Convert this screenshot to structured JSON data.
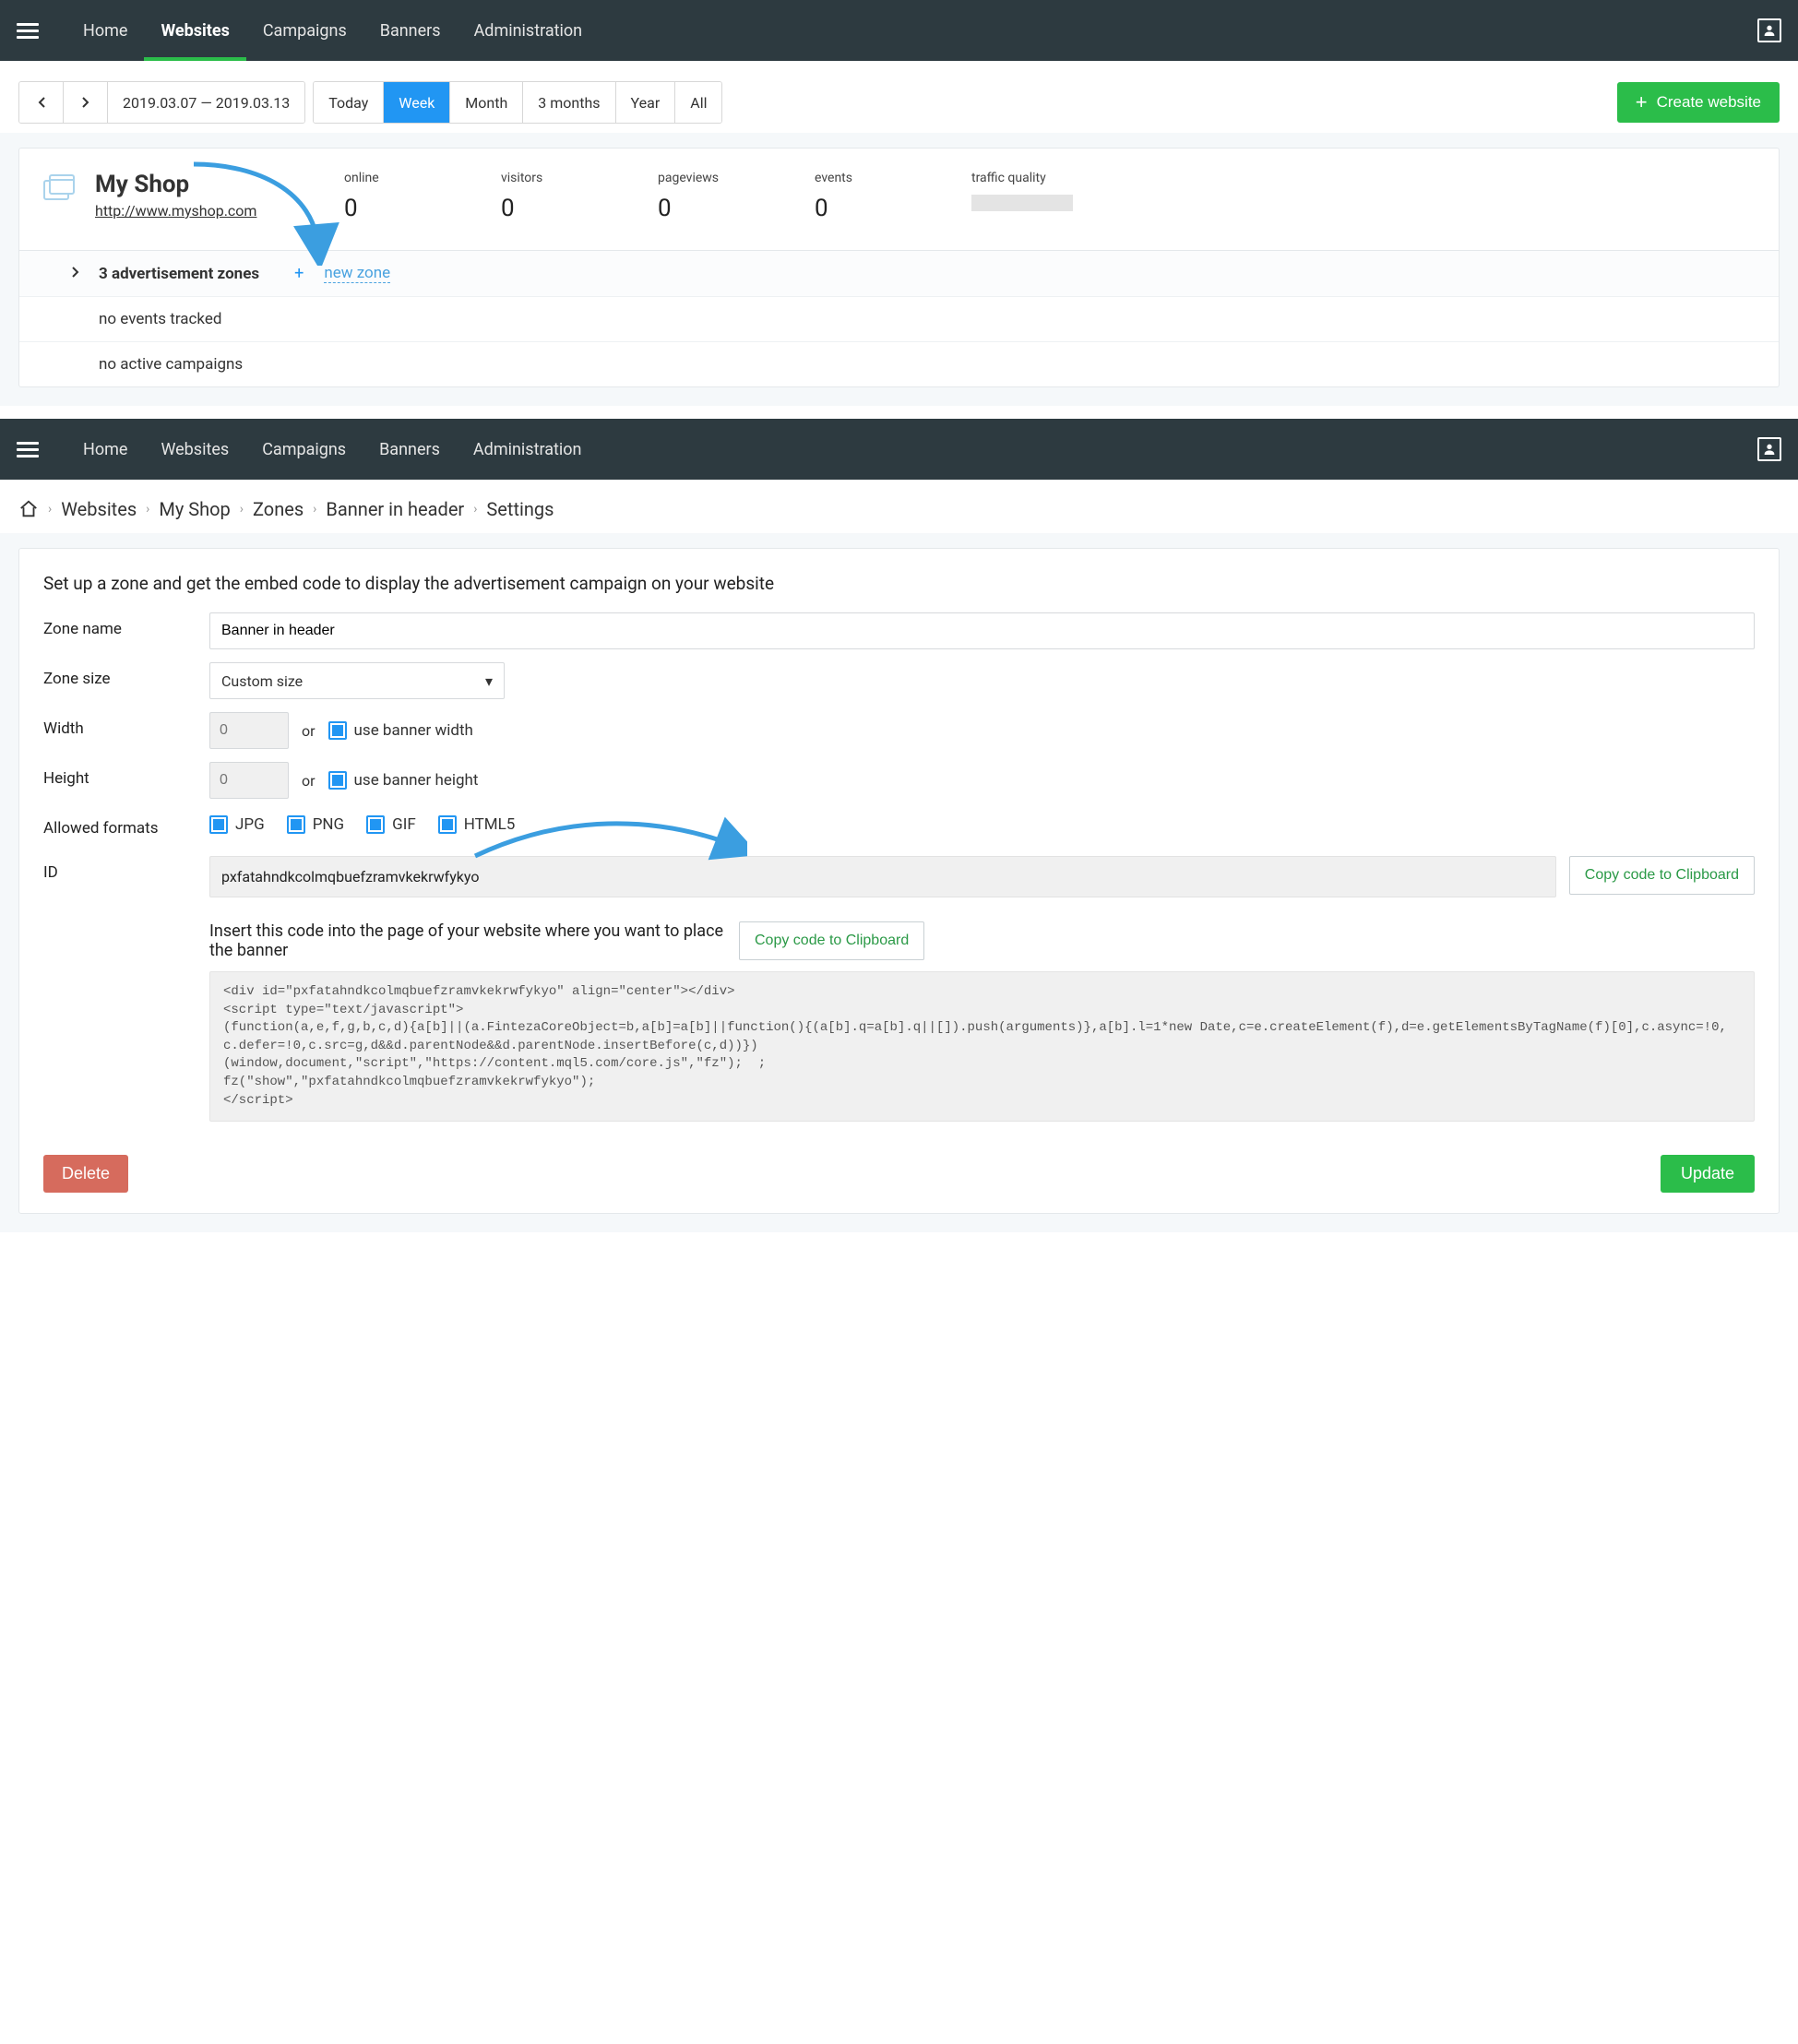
{
  "header": {
    "nav": [
      "Home",
      "Websites",
      "Campaigns",
      "Banners",
      "Administration"
    ],
    "active": "Websites"
  },
  "toolbar": {
    "date_range": "2019.03.07  — 2019.03.13",
    "ranges": [
      "Today",
      "Week",
      "Month",
      "3 months",
      "Year",
      "All"
    ],
    "active_range": "Week",
    "create_website": "Create website"
  },
  "site": {
    "name": "My Shop",
    "url": "http://www.myshop.com",
    "stats": {
      "online": {
        "label": "online",
        "value": "0"
      },
      "visitors": {
        "label": "visitors",
        "value": "0"
      },
      "pageviews": {
        "label": "pageviews",
        "value": "0"
      },
      "events": {
        "label": "events",
        "value": "0"
      }
    },
    "traffic_quality_label": "traffic quality",
    "rows": {
      "zones": "3 advertisement zones",
      "new_zone": "new zone",
      "no_events": "no events tracked",
      "no_campaigns": "no active campaigns"
    }
  },
  "header2": {
    "nav": [
      "Home",
      "Websites",
      "Campaigns",
      "Banners",
      "Administration"
    ]
  },
  "breadcrumb": [
    "Websites",
    "My Shop",
    "Zones",
    "Banner in header",
    "Settings"
  ],
  "form": {
    "intro": "Set up a zone and get the embed code to display the advertisement campaign on your website",
    "labels": {
      "zone_name": "Zone name",
      "zone_size": "Zone size",
      "width": "Width",
      "height": "Height",
      "allowed_formats": "Allowed formats",
      "id": "ID"
    },
    "values": {
      "zone_name": "Banner in header",
      "zone_size": "Custom size",
      "width_placeholder": "0",
      "height_placeholder": "0",
      "or": "or",
      "use_banner_width": "use banner width",
      "use_banner_height": "use banner height",
      "formats": [
        "JPG",
        "PNG",
        "GIF",
        "HTML5"
      ],
      "id": "pxfatahndkcolmqbuefzramvkekrwfykyo",
      "copy_btn": "Copy code to Clipboard",
      "insert_text": "Insert this code into the page of your website where you want to place the banner",
      "code": "<div id=\"pxfatahndkcolmqbuefzramvkekrwfykyo\" align=\"center\"></div>\n<script type=\"text/javascript\">\n(function(a,e,f,g,b,c,d){a[b]||(a.FintezaCoreObject=b,a[b]=a[b]||function(){(a[b].q=a[b].q||[]).push(arguments)},a[b].l=1*new Date,c=e.createElement(f),d=e.getElementsByTagName(f)[0],c.async=!0,c.defer=!0,c.src=g,d&&d.parentNode&&d.parentNode.insertBefore(c,d))})\n(window,document,\"script\",\"https://content.mql5.com/core.js\",\"fz\");  ;\nfz(\"show\",\"pxfatahndkcolmqbuefzramvkekrwfykyo\");\n</script>"
    },
    "buttons": {
      "delete": "Delete",
      "update": "Update"
    }
  }
}
